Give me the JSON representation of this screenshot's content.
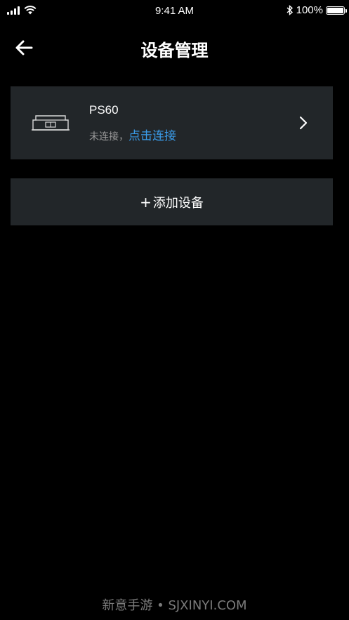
{
  "status_bar": {
    "time": "9:41 AM",
    "battery": "100%",
    "battery_level": 1.0
  },
  "header": {
    "back_icon": "arrow-left-icon",
    "title": "设备管理"
  },
  "device": {
    "icon": "keyboard-icon",
    "name": "PS60",
    "status": "未连接，",
    "connect_label": "点击连接",
    "chevron_icon": "chevron-right-icon",
    "link_color": "#3a9be8"
  },
  "add_device": {
    "plus": "+",
    "label": "添加设备"
  },
  "watermark": {
    "text": "新意手游 • SJXINYI.COM"
  },
  "colors": {
    "background": "#000000",
    "card": "#222629",
    "secondary_text": "#9a9a9a"
  }
}
